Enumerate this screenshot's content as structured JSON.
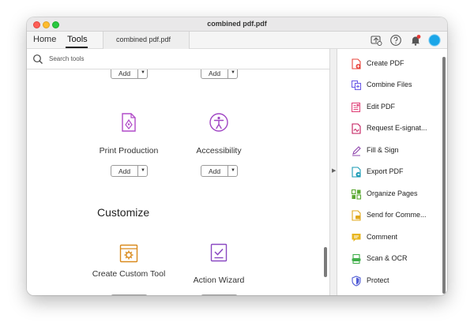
{
  "window": {
    "title": "combined pdf.pdf"
  },
  "tabs": {
    "home": "Home",
    "tools": "Tools",
    "document": "combined pdf.pdf"
  },
  "search": {
    "placeholder": "Search tools"
  },
  "tools": {
    "add_label": "Add",
    "print_production": "Print Production",
    "accessibility": "Accessibility",
    "customize_heading": "Customize",
    "create_custom_tool": "Create Custom Tool",
    "action_wizard": "Action Wizard"
  },
  "right_panel": {
    "items": [
      {
        "label": "Create PDF",
        "icon": "create-pdf-icon",
        "color": "#e8453c"
      },
      {
        "label": "Combine Files",
        "icon": "combine-files-icon",
        "color": "#6c5ce7"
      },
      {
        "label": "Edit PDF",
        "icon": "edit-pdf-icon",
        "color": "#e0457b"
      },
      {
        "label": "Request E-signat...",
        "icon": "request-esign-icon",
        "color": "#c2185b"
      },
      {
        "label": "Fill & Sign",
        "icon": "fill-sign-icon",
        "color": "#8e44ad"
      },
      {
        "label": "Export PDF",
        "icon": "export-pdf-icon",
        "color": "#1a9bb5"
      },
      {
        "label": "Organize Pages",
        "icon": "organize-pages-icon",
        "color": "#5aa832"
      },
      {
        "label": "Send for Comme...",
        "icon": "send-comment-icon",
        "color": "#e0a81c"
      },
      {
        "label": "Comment",
        "icon": "comment-icon",
        "color": "#e7b51f"
      },
      {
        "label": "Scan & OCR",
        "icon": "scan-ocr-icon",
        "color": "#3fae49"
      },
      {
        "label": "Protect",
        "icon": "protect-icon",
        "color": "#4f5bd5"
      }
    ]
  }
}
